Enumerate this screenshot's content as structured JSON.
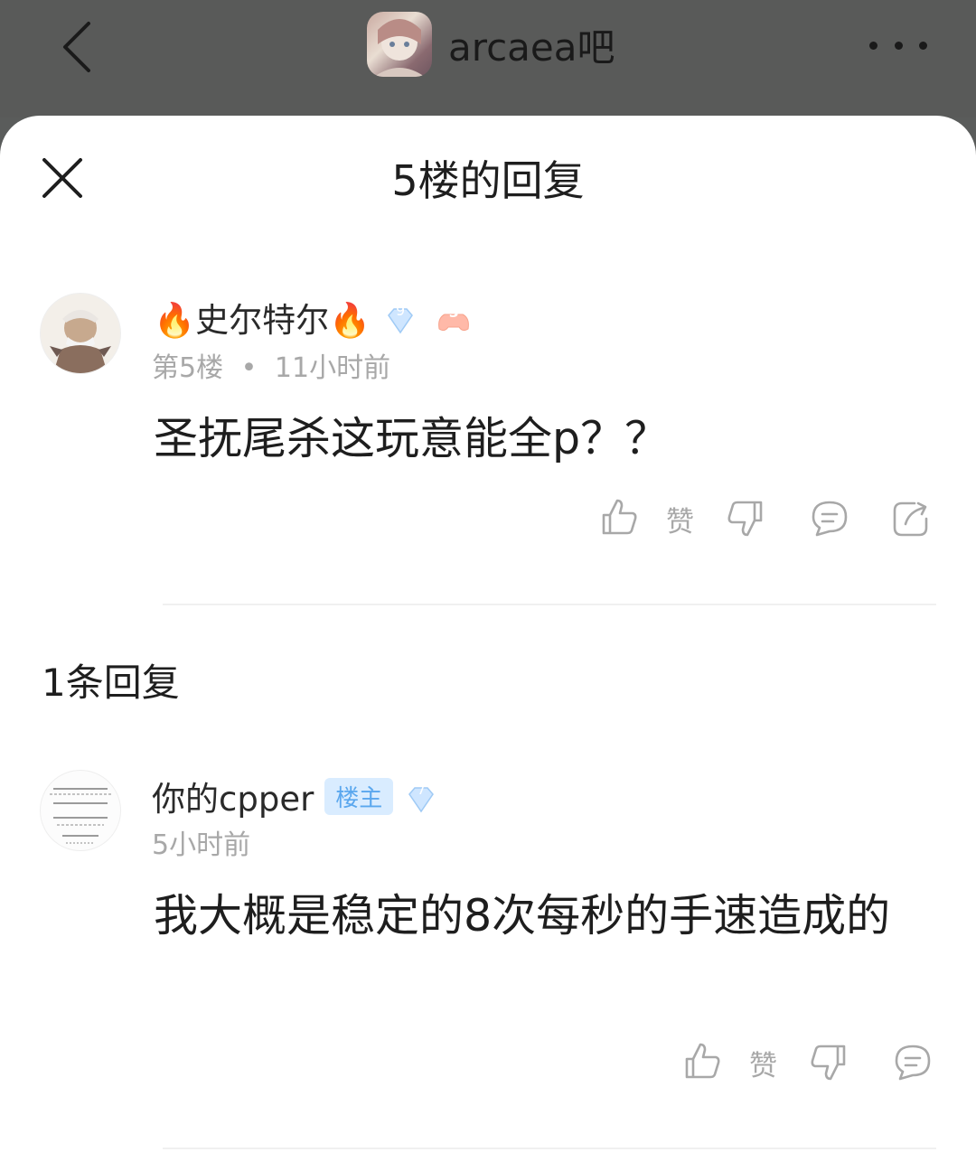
{
  "header": {
    "forum_name": "arcaea吧",
    "back_icon": "chevron-left-icon",
    "more_icon": "more-dots-icon"
  },
  "sheet": {
    "title": "5楼的回复",
    "close_icon": "close-icon"
  },
  "main_post": {
    "username": "🔥史尔特尔🔥",
    "level": "9",
    "medal": "5",
    "floor": "第5楼",
    "separator": "•",
    "time": "11小时前",
    "content": "圣抚尾杀这玩意能全p？？",
    "actions": {
      "like_label": "赞"
    }
  },
  "replies_header": "1条回复",
  "reply": {
    "username": "你的cpper",
    "host_badge": "楼主",
    "level": "7",
    "time": "5小时前",
    "content": "我大概是稳定的8次每秒的手速造成的",
    "actions": {
      "like_label": "赞"
    }
  },
  "colors": {
    "accent_blue": "#5aa7ee",
    "meta_gray": "#a8a8a8",
    "dim_overlay": "#595a59"
  }
}
